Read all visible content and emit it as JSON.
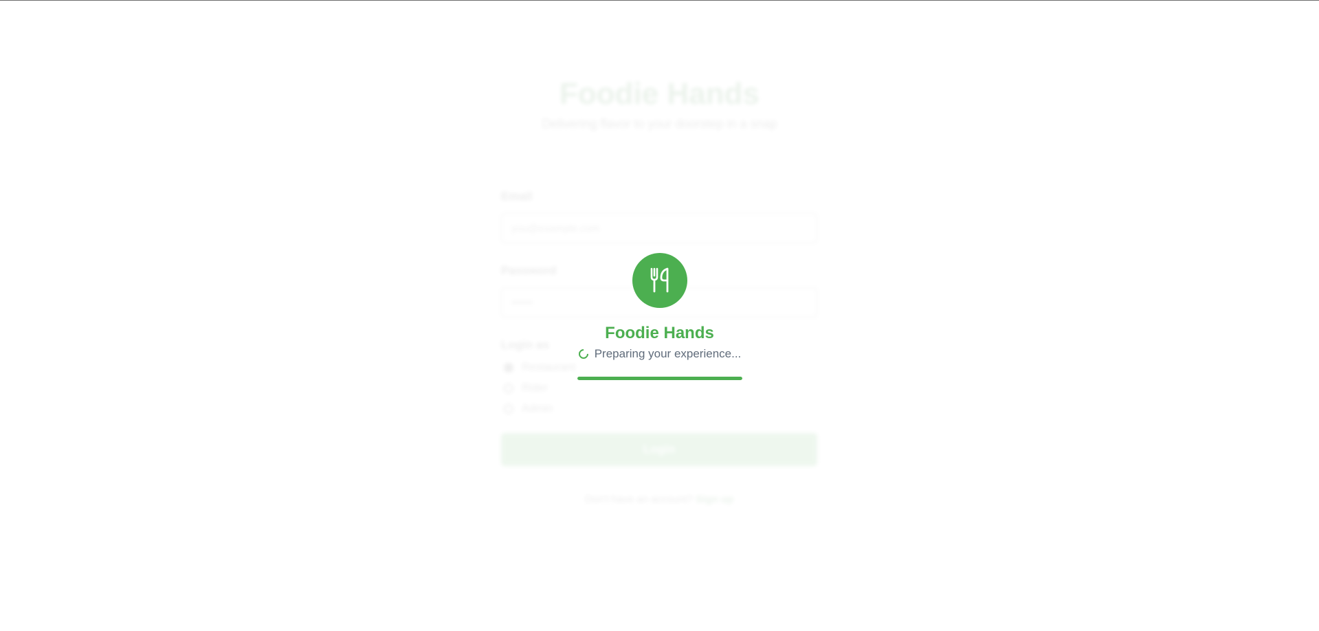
{
  "background": {
    "title": "Foodie Hands",
    "subtitle": "Delivering flavor to your doorstep in a snap",
    "email_label": "Email",
    "email_placeholder": "you@example.com",
    "password_label": "Password",
    "password_placeholder": "••••••",
    "role_label": "Login as",
    "roles": [
      "Restaurant",
      "Rider",
      "Admin"
    ],
    "selected_role": "Restaurant",
    "login_button": "Login",
    "footer_text": "Don't have an account?",
    "footer_link": "Sign up"
  },
  "splash": {
    "icon": "fork-knife-icon",
    "title": "Foodie Hands",
    "status": "Preparing your experience...",
    "progress": 1.0
  },
  "colors": {
    "brand": "#4caf50",
    "status_text": "#5f6b7a"
  }
}
